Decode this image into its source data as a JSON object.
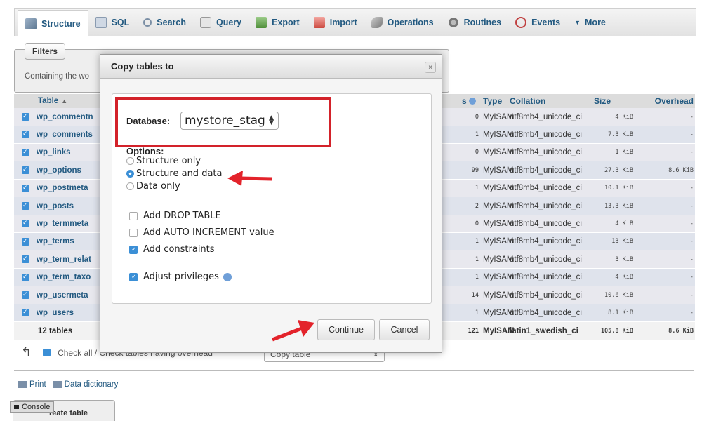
{
  "tabs": [
    {
      "label": "Structure",
      "icon": "structure-icon"
    },
    {
      "label": "SQL",
      "icon": "sql-icon"
    },
    {
      "label": "Search",
      "icon": "search-icon"
    },
    {
      "label": "Query",
      "icon": "query-icon"
    },
    {
      "label": "Export",
      "icon": "export-icon"
    },
    {
      "label": "Import",
      "icon": "import-icon"
    },
    {
      "label": "Operations",
      "icon": "operations-icon"
    },
    {
      "label": "Routines",
      "icon": "routines-icon"
    },
    {
      "label": "Events",
      "icon": "events-icon"
    },
    {
      "label": "More",
      "icon": "caret-down-icon"
    }
  ],
  "filters": {
    "legend": "Filters",
    "text": "Containing the wo"
  },
  "table": {
    "headers": {
      "table": "Table",
      "rows": "s",
      "type": "Type",
      "collation": "Collation",
      "size": "Size",
      "overhead": "Overhead"
    },
    "rows": [
      {
        "name": "wp_commentn",
        "rows": "0",
        "type": "MyISAM",
        "collation": "utf8mb4_unicode_ci",
        "size": "4 KiB",
        "overhead": "-"
      },
      {
        "name": "wp_comments",
        "rows": "1",
        "type": "MyISAM",
        "collation": "utf8mb4_unicode_ci",
        "size": "7.3 KiB",
        "overhead": "-"
      },
      {
        "name": "wp_links",
        "rows": "0",
        "type": "MyISAM",
        "collation": "utf8mb4_unicode_ci",
        "size": "1 KiB",
        "overhead": "-"
      },
      {
        "name": "wp_options",
        "rows": "99",
        "type": "MyISAM",
        "collation": "utf8mb4_unicode_ci",
        "size": "27.3 KiB",
        "overhead": "8.6 KiB"
      },
      {
        "name": "wp_postmeta",
        "rows": "1",
        "type": "MyISAM",
        "collation": "utf8mb4_unicode_ci",
        "size": "10.1 KiB",
        "overhead": "-"
      },
      {
        "name": "wp_posts",
        "rows": "2",
        "type": "MyISAM",
        "collation": "utf8mb4_unicode_ci",
        "size": "13.3 KiB",
        "overhead": "-"
      },
      {
        "name": "wp_termmeta",
        "rows": "0",
        "type": "MyISAM",
        "collation": "utf8mb4_unicode_ci",
        "size": "4 KiB",
        "overhead": "-"
      },
      {
        "name": "wp_terms",
        "rows": "1",
        "type": "MyISAM",
        "collation": "utf8mb4_unicode_ci",
        "size": "13 KiB",
        "overhead": "-"
      },
      {
        "name": "wp_term_relat",
        "rows": "1",
        "type": "MyISAM",
        "collation": "utf8mb4_unicode_ci",
        "size": "3 KiB",
        "overhead": "-"
      },
      {
        "name": "wp_term_taxo",
        "rows": "1",
        "type": "MyISAM",
        "collation": "utf8mb4_unicode_ci",
        "size": "4 KiB",
        "overhead": "-"
      },
      {
        "name": "wp_usermeta",
        "rows": "14",
        "type": "MyISAM",
        "collation": "utf8mb4_unicode_ci",
        "size": "10.6 KiB",
        "overhead": "-"
      },
      {
        "name": "wp_users",
        "rows": "1",
        "type": "MyISAM",
        "collation": "utf8mb4_unicode_ci",
        "size": "8.1 KiB",
        "overhead": "-"
      }
    ],
    "footer": {
      "name": "12 tables",
      "rows": "121",
      "type": "MyISAM",
      "collation": "latin1_swedish_ci",
      "size": "105.8 KiB",
      "overhead": "8.6 KiB"
    }
  },
  "bottom": {
    "check_all": "Check all / Check tables having overhead",
    "action_select": "Copy table",
    "print": "Print",
    "data_dictionary": "Data dictionary",
    "create_table": "reate table",
    "console": "Console"
  },
  "modal": {
    "title": "Copy tables to",
    "close_glyph": "×",
    "database_label": "Database:",
    "database_value": "mystore_stag",
    "options_label": "Options:",
    "radio_options": [
      {
        "label": "Structure only",
        "selected": false
      },
      {
        "label": "Structure and data",
        "selected": true
      },
      {
        "label": "Data only",
        "selected": false
      }
    ],
    "checkboxes": [
      {
        "label": "Add DROP TABLE",
        "checked": false
      },
      {
        "label": "Add AUTO INCREMENT value",
        "checked": false
      },
      {
        "label": "Add constraints",
        "checked": true
      },
      {
        "label": "Adjust privileges",
        "checked": true
      }
    ],
    "continue_label": "Continue",
    "cancel_label": "Cancel"
  },
  "colors": {
    "highlight_box": "#d3222a",
    "arrow": "#e3232b",
    "link": "#235a81",
    "checkbox": "#3b8fd6"
  }
}
